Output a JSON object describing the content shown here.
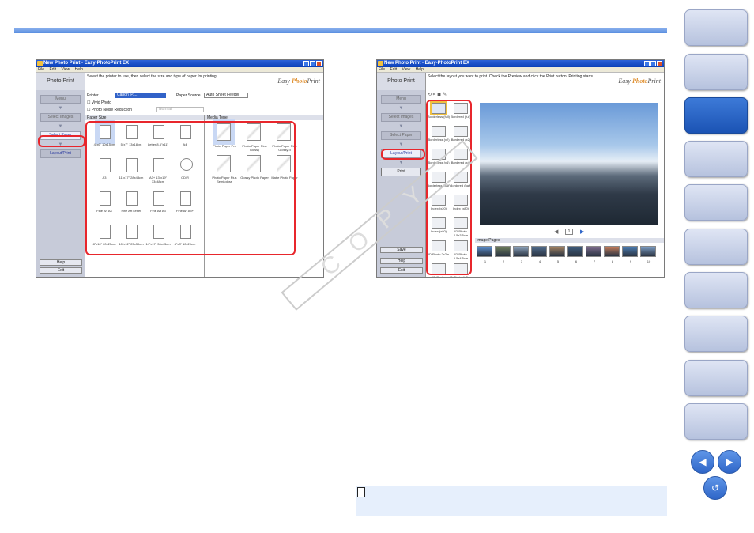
{
  "win1": {
    "title": "New Photo Print - Easy-PhotoPrint EX",
    "menu": [
      "File",
      "Edit",
      "View",
      "Help"
    ],
    "side_title": "Photo Print",
    "steps": [
      "Menu",
      "Select Images",
      "Select Paper",
      "Layout/Print"
    ],
    "help": "Help",
    "exit": "Exit",
    "instruction": "Select the printer to use, then select the size and type of paper for printing.",
    "printer_label": "Printer",
    "printer_value": "Canon iP....",
    "source_label": "Paper Source",
    "source_value": "Auto Sheet Feeder",
    "vivid": "Vivid Photo",
    "noise": "Photo Noise Reduction",
    "noise_value": "Normal",
    "paper_size_header": "Paper Size",
    "media_type_header": "Media Type",
    "sizes": [
      "4\"x6\" 10x15cm",
      "5\"x7\" 13x18cm",
      "Letter 8.5\"x11\"",
      "A4",
      "A3",
      "11\"x17\" 28x43cm",
      "A3+ 13\"x19\" 33x48cm",
      "CD/R",
      "Fine Art A4",
      "Fine Art Letter",
      "Fine Art A3",
      "Fine Art A3+",
      "8\"x10\" 20x25cm",
      "10\"x12\" 25x30cm",
      "14\"x17\" 36x43cm",
      "4\"x8\" 10x20cm"
    ],
    "media": [
      "Photo Paper Pro",
      "Photo Paper Plus Glossy",
      "Photo Paper Plus Glossy II",
      "Photo Paper Plus Semi-gloss",
      "Glossy Photo Paper",
      "Matte Photo Paper"
    ]
  },
  "win2": {
    "title": "New Photo Print - Easy-PhotoPrint EX",
    "menu": [
      "File",
      "Edit",
      "View",
      "Help"
    ],
    "side_title": "Photo Print",
    "steps": [
      "Menu",
      "Select Images",
      "Select Paper",
      "Layout/Print"
    ],
    "print": "Print",
    "save": "Save",
    "help": "Help",
    "exit": "Exit",
    "instruction": "Select the layout you want to print. Check the Preview and click the Print button. Printing starts.",
    "layouts": [
      "Borderless (full)",
      "Bordered (full)",
      "Borderless (x2)",
      "Bordered (x2)",
      "Borderless (x4)",
      "Bordered (x4)",
      "Borderless (half)",
      "Bordered (half)",
      "Index (x20)",
      "Index (x80)",
      "Index (x80)",
      "ID Photo 4.5x3.5cm",
      "ID Photo 2x2in",
      "ID Photo 5.5x4.5cm",
      "ID Photo 4.5x3.5cm",
      "ID Photo 4x3cm"
    ],
    "page_number": "1",
    "image_pages": "Image Pages",
    "page_numbers": [
      "1",
      "2",
      "3",
      "4",
      "5",
      "6",
      "7",
      "8",
      "9",
      "10"
    ]
  },
  "colors": {
    "accent_red": "#e8262c",
    "nav_blue": "#2f66c8"
  }
}
